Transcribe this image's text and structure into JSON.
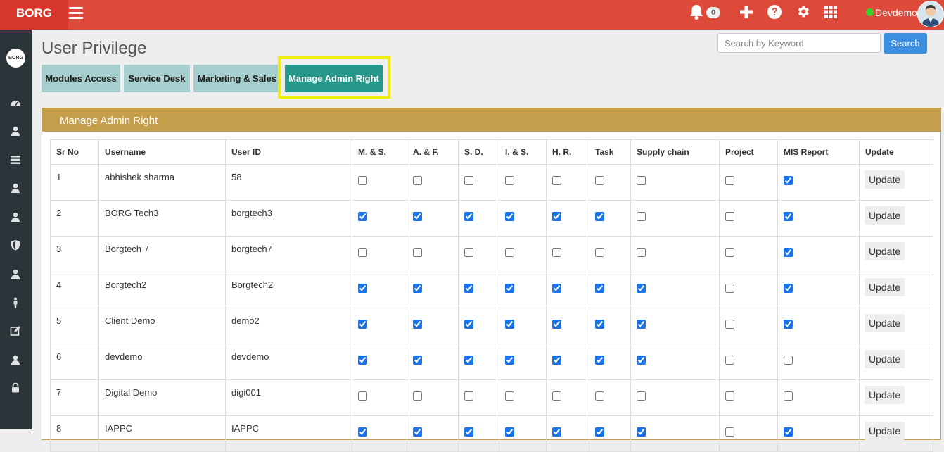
{
  "app": {
    "brand": "BORG"
  },
  "topbar": {
    "notification_count": "0",
    "user_name": "Devdemo",
    "status_color": "#39d32b"
  },
  "sidebar": {
    "logo_text": "BORG"
  },
  "page": {
    "title": "User Privilege"
  },
  "search": {
    "placeholder": "Search by Keyword",
    "value": "",
    "button_label": "Search"
  },
  "tabs": [
    {
      "label": "Modules Access",
      "active": false
    },
    {
      "label": "Service Desk",
      "active": false
    },
    {
      "label": "Marketing & Sales",
      "active": false
    },
    {
      "label": "Manage Admin Right",
      "active": true
    }
  ],
  "panel": {
    "title": "Manage Admin Right"
  },
  "table": {
    "columns": [
      "Sr No",
      "Username",
      "User ID",
      "M. & S.",
      "A. & F.",
      "S. D.",
      "I. & S.",
      "H. R.",
      "Task",
      "Supply chain",
      "Project",
      "MIS Report",
      "Update"
    ],
    "update_label": "Update",
    "rows": [
      {
        "sr": "1",
        "username": "abhishek sharma",
        "userid": "58",
        "rights": [
          false,
          false,
          false,
          false,
          false,
          false,
          false,
          false,
          true
        ]
      },
      {
        "sr": "2",
        "username": "BORG Tech3",
        "userid": "borgtech3",
        "rights": [
          true,
          true,
          true,
          true,
          true,
          true,
          false,
          false,
          true
        ]
      },
      {
        "sr": "3",
        "username": "Borgtech 7",
        "userid": "borgtech7",
        "rights": [
          false,
          false,
          false,
          false,
          false,
          false,
          false,
          false,
          true
        ]
      },
      {
        "sr": "4",
        "username": "Borgtech2",
        "userid": "Borgtech2",
        "rights": [
          true,
          true,
          true,
          true,
          true,
          true,
          true,
          false,
          true
        ]
      },
      {
        "sr": "5",
        "username": "Client Demo",
        "userid": "demo2",
        "rights": [
          true,
          true,
          true,
          true,
          true,
          true,
          true,
          false,
          true
        ]
      },
      {
        "sr": "6",
        "username": "devdemo",
        "userid": "devdemo",
        "rights": [
          true,
          true,
          true,
          true,
          true,
          true,
          true,
          false,
          false
        ]
      },
      {
        "sr": "7",
        "username": "Digital Demo",
        "userid": "digi001",
        "rights": [
          false,
          false,
          false,
          false,
          false,
          false,
          false,
          false,
          false
        ]
      },
      {
        "sr": "8",
        "username": "IAPPC",
        "userid": "IAPPC",
        "rights": [
          true,
          true,
          true,
          true,
          true,
          true,
          true,
          false,
          true
        ]
      }
    ]
  },
  "colors": {
    "topbar": "#de4a3a",
    "sidebar": "#2b3539",
    "tab": "#a8cfcf",
    "tab_active": "#26988b",
    "panel_header": "#c59e4b",
    "highlight": "#f0ec12",
    "search_button": "#3c8ee0"
  }
}
